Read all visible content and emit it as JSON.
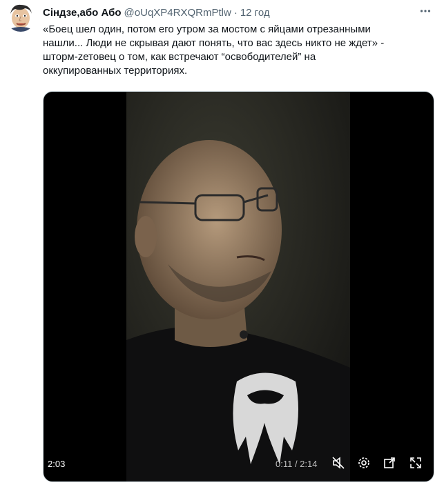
{
  "tweet": {
    "display_name": "Сiндзе,або Або",
    "handle": "@oUqXP4RXQRmPtlw",
    "separator": "·",
    "time": "12 год",
    "text_lines": [
      "«Боец шел один, потом его утром за мостом с яйцами отрезанными",
      "нашли... Люди не скрывая дают понять, что вас здесь никто не ждет» -",
      "шторм-zетовец о том, как встречают “освободителей” на",
      "оккупированных территориях."
    ]
  },
  "video": {
    "remaining_time": "2:03",
    "progress_time": "0:11 / 2:14",
    "progress_fraction": 0.08
  },
  "icons": {
    "more": "more-horizontal-icon",
    "mute": "speaker-muted-icon",
    "settings": "gear-icon",
    "popout": "popout-icon",
    "fullscreen": "fullscreen-icon"
  },
  "colors": {
    "text": "#0f1419",
    "secondary": "#536471",
    "media_bg": "#000000"
  }
}
